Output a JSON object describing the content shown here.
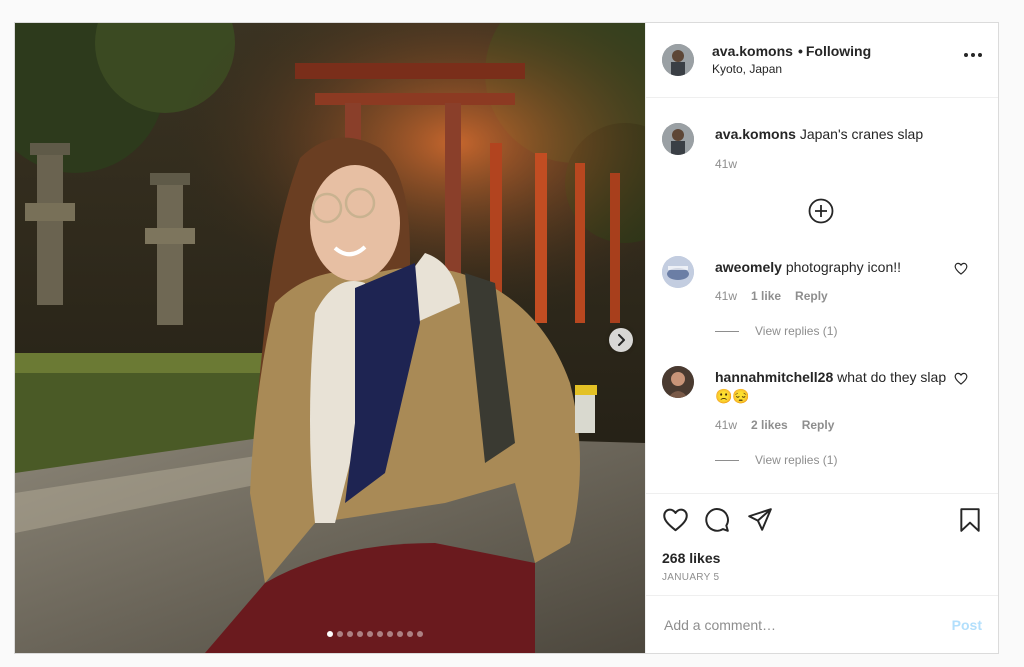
{
  "post": {
    "username": "ava.komons",
    "follow_status": "Following",
    "location": "Kyoto, Japan",
    "caption": "Japan's cranes slap",
    "caption_age": "41w",
    "likes_text": "268 likes",
    "date": "JANUARY 5",
    "carousel": {
      "slide_count": 10,
      "active_slide": 1
    }
  },
  "comments": [
    {
      "username": "aweomely",
      "text": "photography icon!!",
      "age": "41w",
      "likes": "1 like",
      "reply_label": "Reply",
      "view_replies": "View replies (1)"
    },
    {
      "username": "hannahmitchell28",
      "text": "what do they slap🙁😔",
      "age": "41w",
      "likes": "2 likes",
      "reply_label": "Reply",
      "view_replies": "View replies (1)"
    }
  ],
  "composer": {
    "placeholder": "Add a comment…",
    "post_label": "Post"
  },
  "icons": {
    "more": "more-horizontal-icon",
    "like": "heart-icon",
    "comment": "comment-icon",
    "share": "paper-plane-icon",
    "save": "bookmark-icon",
    "load_more": "plus-circle-icon",
    "next": "chevron-right-icon"
  },
  "colors": {
    "link_disabled": "#b2dffc",
    "secondary_text": "#8e8e8e",
    "primary_text": "#262626"
  }
}
